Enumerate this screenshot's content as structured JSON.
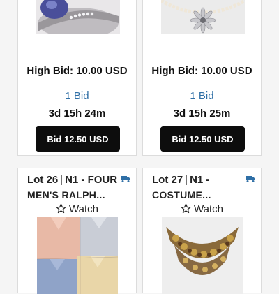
{
  "top_cards": [
    {
      "image_alt": "ring",
      "high_bid_label": "High Bid: 10.00 USD",
      "bid_count": "1 Bid",
      "time_left": "3d 15h 24m",
      "bid_button": "Bid 12.50 USD"
    },
    {
      "image_alt": "necklace",
      "high_bid_label": "High Bid: 10.00 USD",
      "bid_count": "1 Bid",
      "time_left": "3d 15h 25m",
      "bid_button": "Bid 12.50 USD"
    }
  ],
  "lot_cards": [
    {
      "lot_label": "Lot 26",
      "title_line1": "N1 - FOUR",
      "title_line2": "MEN'S RALPH...",
      "watch_label": "Watch",
      "icon": "truck-icon"
    },
    {
      "lot_label": "Lot 27",
      "title_line1": "N1 -",
      "title_line2": "COSTUME...",
      "watch_label": "Watch",
      "icon": "truck-icon"
    }
  ],
  "colors": {
    "link_blue": "#2f6fa6",
    "button_black": "#0d0d0d",
    "truck_blue": "#2f6fa6"
  }
}
